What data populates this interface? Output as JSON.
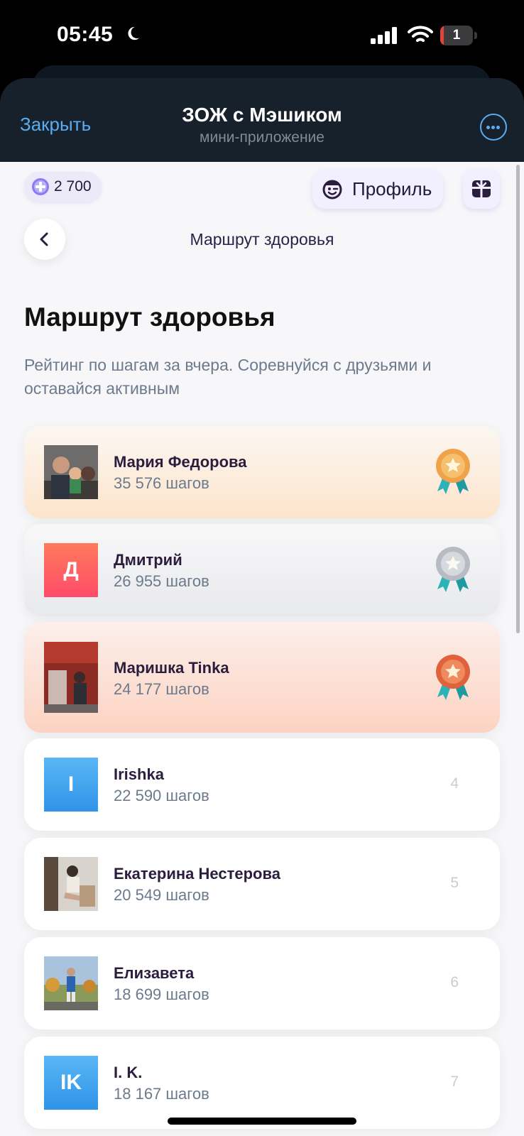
{
  "status_bar": {
    "time": "05:45",
    "battery": "1",
    "battery_level": 0.1
  },
  "header": {
    "close_label": "Закрыть",
    "title": "ЗОЖ с Мэшиком",
    "subtitle": "мини-приложение"
  },
  "top_bar": {
    "points": "2 700",
    "profile_label": "Профиль"
  },
  "nav": {
    "title": "Маршрут здоровья"
  },
  "page": {
    "heading": "Маршрут здоровья",
    "description": "Рейтинг по шагам за вчера. Соревнуйся с друзьями и оставайся активным"
  },
  "leaderboard": [
    {
      "rank": "1",
      "name": "Мария Федорова",
      "steps": "35 576 шагов",
      "avatar": "photo",
      "medal": "gold"
    },
    {
      "rank": "2",
      "name": "Дмитрий",
      "steps": "26 955 шагов",
      "avatar": "Д",
      "avatar_color": "#ff5a64",
      "medal": "silver"
    },
    {
      "rank": "3",
      "name": "Маришка Tinka",
      "steps": "24 177 шагов",
      "avatar": "photo",
      "medal": "bronze"
    },
    {
      "rank": "4",
      "name": "Irishka",
      "steps": "22 590 шагов",
      "avatar": "I",
      "avatar_color": "#3aa3ef"
    },
    {
      "rank": "5",
      "name": "Екатерина Нестерова",
      "steps": "20 549 шагов",
      "avatar": "photo"
    },
    {
      "rank": "6",
      "name": "Елизавета",
      "steps": "18 699 шагов",
      "avatar": "photo"
    },
    {
      "rank": "7",
      "name": "I. K.",
      "steps": "18 167 шагов",
      "avatar": "IK",
      "avatar_color": "#3aa3ef"
    }
  ],
  "colors": {
    "accent_link": "#5aacf2",
    "header_bg": "#17212b",
    "brand_purple": "#2a1d3d"
  }
}
